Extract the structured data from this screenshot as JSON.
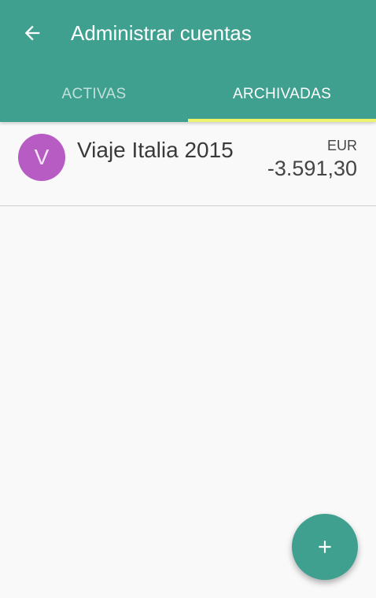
{
  "header": {
    "title": "Administrar cuentas",
    "back_icon": "arrow-back-icon"
  },
  "tabs": [
    {
      "label": "ACTIVAS",
      "selected": false
    },
    {
      "label": "ARCHIVADAS",
      "selected": true
    }
  ],
  "accounts": [
    {
      "avatar_letter": "V",
      "name": "Viaje Italia 2015",
      "currency": "EUR",
      "balance": "-3.591,30"
    }
  ],
  "fab": {
    "icon": "plus-icon"
  },
  "colors": {
    "primary": "#3fa08f",
    "tab_indicator": "#eef36b",
    "avatar": "#b65cc2",
    "background": "#f9f9f9"
  }
}
